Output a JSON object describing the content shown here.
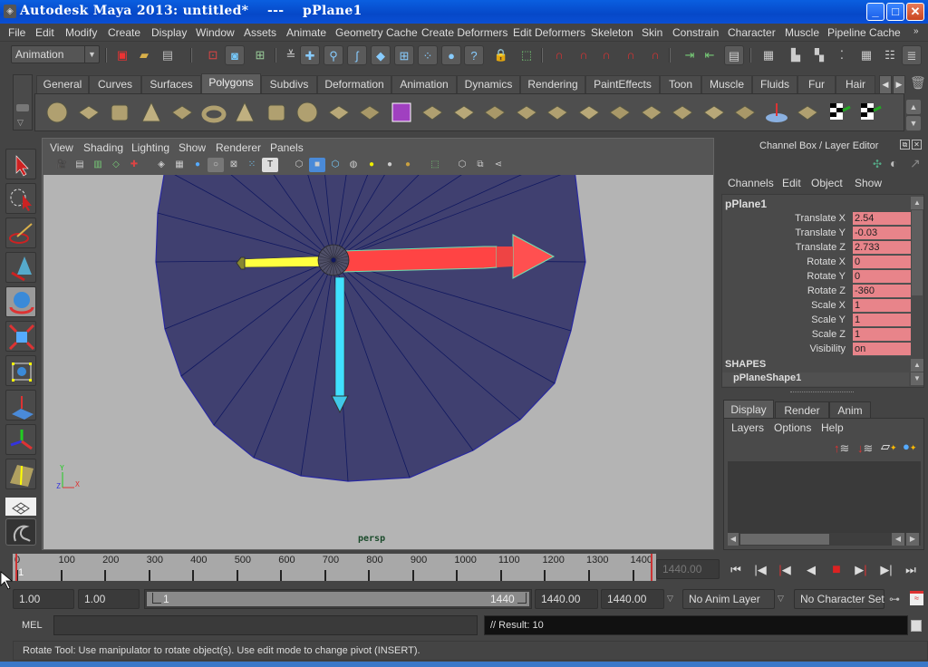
{
  "window": {
    "title": "Autodesk Maya 2013: untitled*    ---    pPlane1",
    "controls": {
      "minimize": "_",
      "maximize": "□",
      "close": "✕"
    }
  },
  "menubar": {
    "items": [
      "File",
      "Edit",
      "Modify",
      "Create",
      "Display",
      "Window",
      "Assets",
      "Animate",
      "Geometry Cache",
      "Create Deformers",
      "Edit Deformers",
      "Skeleton",
      "Skin",
      "Constrain",
      "Character",
      "Muscle",
      "Pipeline Cache"
    ],
    "overflow": "»"
  },
  "statusline": {
    "mode": "Animation",
    "icons": [
      "new-scene-icon",
      "open-scene-icon",
      "save-scene-icon",
      "select-by-hierarchy-icon",
      "select-by-object-icon",
      "select-by-component-icon",
      "snap-grid-icon",
      "snap-curve-icon",
      "snap-point-icon",
      "snap-view-plane-icon",
      "snap-live-icon",
      "render-icon",
      "ipr-render-icon",
      "render-settings-icon",
      "hypershade-icon",
      "attribute-editor-icon",
      "tool-settings-icon",
      "channel-box-icon"
    ]
  },
  "shelf": {
    "tabs": [
      "General",
      "Curves",
      "Surfaces",
      "Polygons",
      "Subdivs",
      "Deformation",
      "Animation",
      "Dynamics",
      "Rendering",
      "PaintEffects",
      "Toon",
      "Muscle",
      "Fluids",
      "Fur",
      "Hair"
    ],
    "active_tab": "Polygons",
    "icons": [
      "poly-sphere",
      "poly-cube",
      "poly-cylinder",
      "poly-cone",
      "poly-plane",
      "poly-torus",
      "poly-pyramid",
      "poly-pipe",
      "poly-soccer-ball",
      "combine",
      "separate",
      "smooth",
      "poly-extract",
      "extrude",
      "bridge",
      "append-to-polygon",
      "split-polygon",
      "insert-edge-loop",
      "offset-edge-loop",
      "merge",
      "fill-hole",
      "wedge",
      "chamfer",
      "sculpt",
      "planar-mapping",
      "automatic-mapping",
      "uv-editor"
    ]
  },
  "viewport": {
    "menu": [
      "View",
      "Shading",
      "Lighting",
      "Show",
      "Renderer",
      "Panels"
    ],
    "camera_label": "persp",
    "axis": {
      "x": "X",
      "y": "Y",
      "z": "Z"
    },
    "colors": {
      "background": "#b4b4b4",
      "mesh": "#404070",
      "wire": "#101860",
      "x_axis": "#ff4040",
      "y_axis": "#ffff40",
      "z_axis": "#40e0ff"
    }
  },
  "toolbox": {
    "tools": [
      "select-tool",
      "lasso-tool",
      "paint-select-tool",
      "last-tool",
      "rotate-tool",
      "scale-tool",
      "universal-manipulator",
      "soft-mod-tool",
      "move-tool",
      "show-manipulator"
    ],
    "active": "rotate-tool"
  },
  "channelbox": {
    "title": "Channel Box / Layer Editor",
    "menu": [
      "Channels",
      "Edit",
      "Object",
      "Show"
    ],
    "object": "pPlane1",
    "channels": [
      {
        "label": "Translate X",
        "value": "2.54"
      },
      {
        "label": "Translate Y",
        "value": "-0.03"
      },
      {
        "label": "Translate Z",
        "value": "2.733"
      },
      {
        "label": "Rotate X",
        "value": "0"
      },
      {
        "label": "Rotate Y",
        "value": "0"
      },
      {
        "label": "Rotate Z",
        "value": "-360"
      },
      {
        "label": "Scale X",
        "value": "1"
      },
      {
        "label": "Scale Y",
        "value": "1"
      },
      {
        "label": "Scale Z",
        "value": "1"
      },
      {
        "label": "Visibility",
        "value": "on"
      }
    ],
    "shapes_header": "SHAPES",
    "shape_name": "pPlaneShape1"
  },
  "layereditor": {
    "tabs": [
      "Display",
      "Render",
      "Anim"
    ],
    "active_tab": "Display",
    "menu": [
      "Layers",
      "Options",
      "Help"
    ]
  },
  "timeline": {
    "ticks": [
      "0",
      "100",
      "200",
      "300",
      "400",
      "500",
      "600",
      "700",
      "800",
      "900",
      "1000",
      "1100",
      "1200",
      "1300",
      "1400"
    ],
    "current_frame_marker": "1",
    "current_time": "1440.00",
    "max": 1440
  },
  "rangeslider": {
    "start_time": "1.00",
    "playback_start": "1.00",
    "range_start": "1",
    "range_end": "1440",
    "playback_end": "1440.00",
    "end_time": "1440.00",
    "anim_layer": "No Anim Layer",
    "character_set": "No Character Set"
  },
  "commandline": {
    "label": "MEL",
    "input": "",
    "result": "// Result: 10"
  },
  "helpline": {
    "text": "Rotate Tool: Use manipulator to rotate object(s). Use edit mode to change pivot (INSERT)."
  }
}
